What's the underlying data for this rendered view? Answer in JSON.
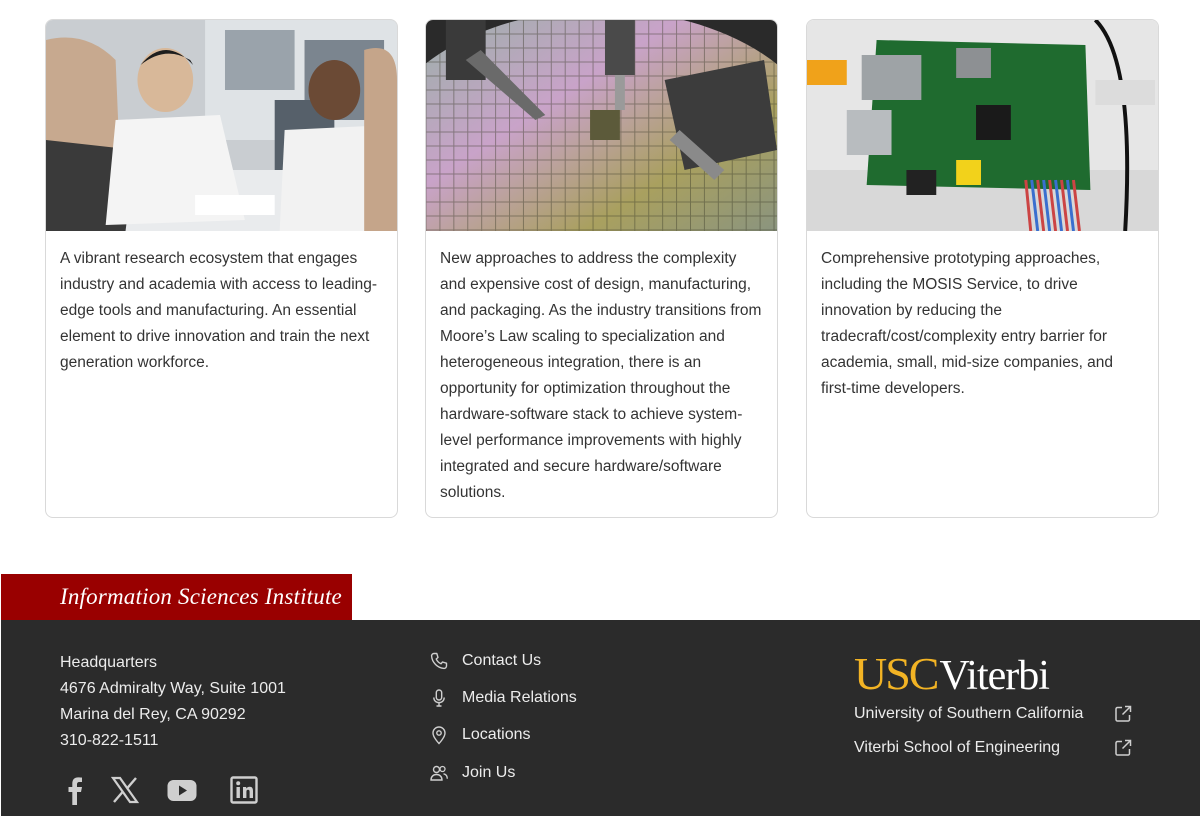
{
  "cards": [
    {
      "image": "researchers-meeting-photo",
      "text": "A vibrant research ecosystem that engages industry and academia with access to leading-edge tools and manufacturing. An essential element to drive innovation and train the next generation workforce."
    },
    {
      "image": "wafer-probe-photo",
      "text": "New approaches to address the complexity and expensive cost of design, manufacturing, and packaging. As the industry transitions from Moore’s Law scaling to specialization and heterogeneous integration, there is an opportunity for optimization throughout the hardware-software stack to achieve system-level performance improvements with highly integrated and secure hardware/software solutions."
    },
    {
      "image": "circuit-board-photo",
      "text": "Comprehensive prototyping approaches, including the MOSIS Service, to drive innovation by reducing the tradecraft/cost/complexity entry barrier for academia, small, mid-size companies, and first-time developers."
    }
  ],
  "brand_tab": "Information Sciences Institute",
  "footer": {
    "address": {
      "label": "Headquarters",
      "line1": "4676 Admiralty Way, Suite 1001",
      "line2": "Marina del Rey, CA 90292",
      "phone": "310-822-1511"
    },
    "social": [
      "facebook-icon",
      "x-icon",
      "youtube-icon",
      "linkedin-icon"
    ],
    "links": [
      {
        "icon": "phone-icon",
        "label": "Contact Us"
      },
      {
        "icon": "microphone-icon",
        "label": "Media Relations"
      },
      {
        "icon": "map-pin-icon",
        "label": "Locations"
      },
      {
        "icon": "people-icon",
        "label": "Join Us"
      }
    ],
    "logo": {
      "usc": "USC",
      "viterbi": "Viterbi"
    },
    "external_links": [
      {
        "label": "University of Southern California",
        "icon": "external-link-icon"
      },
      {
        "label": "Viterbi School of Engineering",
        "icon": "external-link-icon"
      }
    ]
  },
  "colors": {
    "brand_red": "#990000",
    "footer_bg": "#2b2b2b",
    "usc_gold": "#f2b324"
  }
}
